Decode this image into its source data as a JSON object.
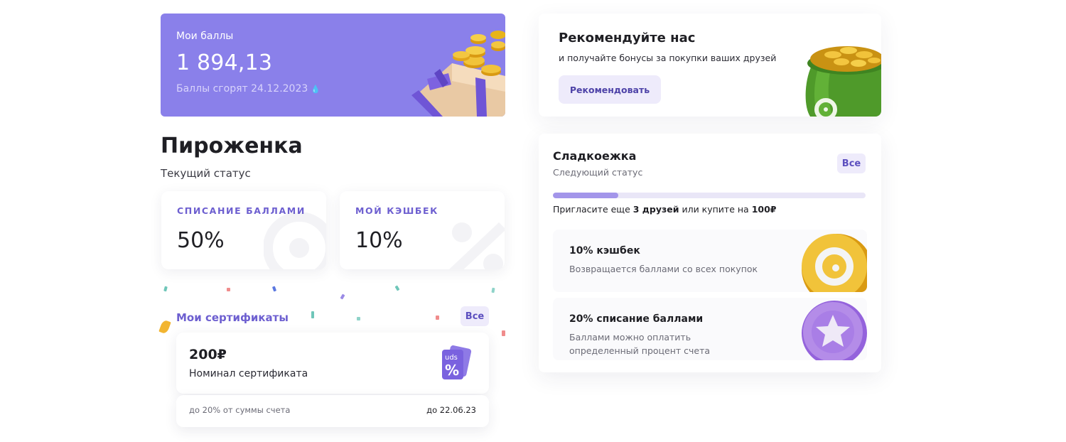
{
  "points": {
    "label": "Мои баллы",
    "value": "1 894,13",
    "expire_text": "Баллы сгорят 24.12.2023",
    "expire_icon": "fire-icon"
  },
  "status": {
    "name": "Пироженка",
    "subtitle": "Текущий статус"
  },
  "perks": [
    {
      "label": "СПИСАНИЕ БАЛЛАМИ",
      "value": "50%"
    },
    {
      "label": "МОЙ КЭШБЕК",
      "value": "10%"
    }
  ],
  "certificates": {
    "title": "Мои сертификаты",
    "all_label": "Все",
    "items": [
      {
        "amount": "200₽",
        "description": "Номинал сертификата",
        "condition": "до 20% от суммы счета",
        "valid_until": "до 22.06.23",
        "icon": "certificate-icon"
      }
    ]
  },
  "referral": {
    "title": "Рекомендуйте нас",
    "subtitle": "и получайте бонусы за покупки ваших друзей",
    "button_label": "Рекомендовать"
  },
  "next_level": {
    "name": "Сладкоежка",
    "subtitle": "Следующий статус",
    "all_label": "Все",
    "progress": 0.21,
    "invite_prefix": "Пригласите еще ",
    "invite_friends": "3 друзей",
    "invite_middle": " или купите на ",
    "invite_amount": "100₽",
    "benefits": [
      {
        "title": "10% кэшбек",
        "description": "Возвращается баллами со всех покупок",
        "icon": "gold-coin-icon"
      },
      {
        "title": "20% списание баллами",
        "description": "Баллами можно оплатить определенный процент счета",
        "icon": "star-coin-icon"
      }
    ]
  },
  "colors": {
    "accent": "#8a80ea",
    "accent_text": "#6d5fd0",
    "button_bg": "#eeebfb",
    "progress": "#a395ea",
    "bag_green": "#4f9a2a",
    "coin_gold": "#e8b41a",
    "coin_purple": "#a97ee6"
  }
}
